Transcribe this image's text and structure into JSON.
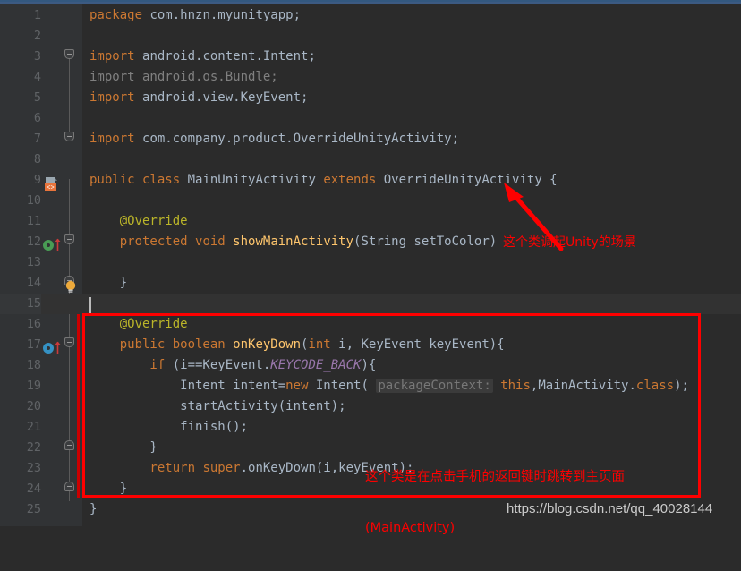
{
  "editor": {
    "theme": "darcula",
    "background": "#2b2b2b",
    "gutter_background": "#313335",
    "line_number_color": "#606366",
    "current_line": 15,
    "lines": [
      {
        "num": "1",
        "segments": [
          {
            "t": "package ",
            "c": "kw"
          },
          {
            "t": "com.hnzn.myunityapp;",
            "c": "pl"
          }
        ]
      },
      {
        "num": "2",
        "segments": []
      },
      {
        "num": "3",
        "segments": [
          {
            "t": "import ",
            "c": "kw"
          },
          {
            "t": "android.content.Intent;",
            "c": "pl"
          }
        ]
      },
      {
        "num": "4",
        "segments": [
          {
            "t": "import android.os.Bundle;",
            "c": "gray"
          }
        ]
      },
      {
        "num": "5",
        "segments": [
          {
            "t": "import ",
            "c": "kw"
          },
          {
            "t": "android.view.KeyEvent;",
            "c": "pl"
          }
        ]
      },
      {
        "num": "6",
        "segments": []
      },
      {
        "num": "7",
        "segments": [
          {
            "t": "import ",
            "c": "kw"
          },
          {
            "t": "com.company.product.OverrideUnityActivity;",
            "c": "pl"
          }
        ]
      },
      {
        "num": "8",
        "segments": []
      },
      {
        "num": "9",
        "segments": [
          {
            "t": "public ",
            "c": "kw"
          },
          {
            "t": "class ",
            "c": "kw"
          },
          {
            "t": "MainUnityActivity ",
            "c": "cls"
          },
          {
            "t": "extends ",
            "c": "kw"
          },
          {
            "t": "OverrideUnityActivity {",
            "c": "cls"
          }
        ]
      },
      {
        "num": "10",
        "segments": []
      },
      {
        "num": "11",
        "segments": [
          {
            "t": "    @Override",
            "c": "ann"
          }
        ]
      },
      {
        "num": "12",
        "segments": [
          {
            "t": "    protected ",
            "c": "kw"
          },
          {
            "t": "void ",
            "c": "kw"
          },
          {
            "t": "showMainActivity",
            "c": "meth"
          },
          {
            "t": "(String setToColor)",
            "c": "pl"
          }
        ]
      },
      {
        "num": "13",
        "segments": []
      },
      {
        "num": "14",
        "segments": [
          {
            "t": "    }",
            "c": "pl"
          }
        ]
      },
      {
        "num": "15",
        "segments": []
      },
      {
        "num": "16",
        "segments": [
          {
            "t": "    @Override",
            "c": "ann"
          }
        ]
      },
      {
        "num": "17",
        "segments": [
          {
            "t": "    public ",
            "c": "kw"
          },
          {
            "t": "boolean ",
            "c": "kw"
          },
          {
            "t": "onKeyDown",
            "c": "meth"
          },
          {
            "t": "(",
            "c": "pl"
          },
          {
            "t": "int",
            "c": "kw"
          },
          {
            "t": " i, KeyEvent keyEvent){",
            "c": "pl"
          }
        ]
      },
      {
        "num": "18",
        "segments": [
          {
            "t": "        if ",
            "c": "kw"
          },
          {
            "t": "(i==KeyEvent.",
            "c": "pl"
          },
          {
            "t": "KEYCODE_BACK",
            "c": "stat"
          },
          {
            "t": "){",
            "c": "pl"
          }
        ]
      },
      {
        "num": "19",
        "segments": [
          {
            "t": "            Intent intent=",
            "c": "pl"
          },
          {
            "t": "new ",
            "c": "kw"
          },
          {
            "t": "Intent( ",
            "c": "pl"
          },
          {
            "t": "packageContext:",
            "c": "hint"
          },
          {
            "t": " ",
            "c": "pl"
          },
          {
            "t": "this",
            "c": "kw"
          },
          {
            "t": ",MainActivity.",
            "c": "pl"
          },
          {
            "t": "class",
            "c": "kw"
          },
          {
            "t": ");",
            "c": "pl"
          }
        ]
      },
      {
        "num": "20",
        "segments": [
          {
            "t": "            startActivity(intent);",
            "c": "pl"
          }
        ]
      },
      {
        "num": "21",
        "segments": [
          {
            "t": "            finish();",
            "c": "pl"
          }
        ]
      },
      {
        "num": "22",
        "segments": [
          {
            "t": "        }",
            "c": "pl"
          }
        ]
      },
      {
        "num": "23",
        "segments": [
          {
            "t": "        return ",
            "c": "kw"
          },
          {
            "t": "super",
            "c": "kw"
          },
          {
            "t": ".onKeyDown(i,keyEvent);",
            "c": "pl"
          }
        ]
      },
      {
        "num": "24",
        "segments": [
          {
            "t": "    }",
            "c": "pl"
          }
        ]
      },
      {
        "num": "25",
        "segments": [
          {
            "t": "}",
            "c": "pl"
          }
        ]
      }
    ]
  },
  "gutter_markers": {
    "line9_icon": "android-activity-class-icon",
    "line12_icon": "implements-method-green-icon",
    "line14_icon": "intention-lightbulb-icon",
    "line17_icon": "overrides-method-blue-icon"
  },
  "annotations": {
    "box_color": "#fe0000",
    "note_unity": "这个类调起Unity的场景",
    "note_back_line1": "这个类是在点击手机的返回键时跳转到主页面",
    "note_back_line2": "(MainActivity)",
    "arrow": "red-arrow-pointing-up-left"
  },
  "watermark": {
    "text": "https://blog.csdn.net/qq_40028144"
  }
}
